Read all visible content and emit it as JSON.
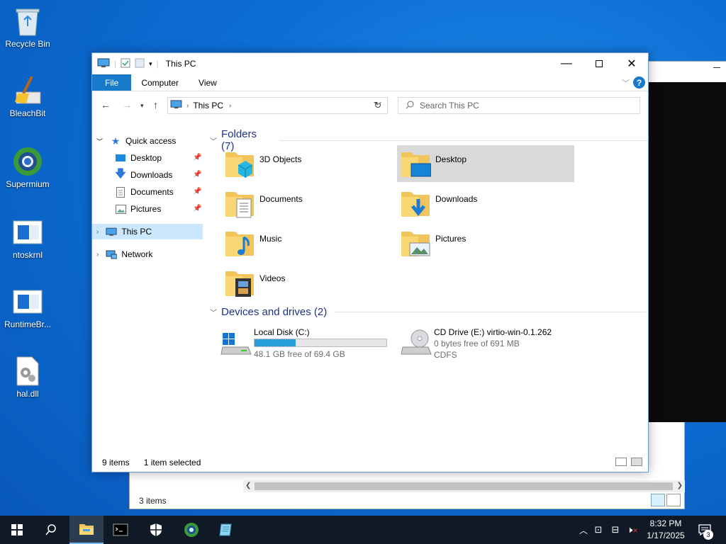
{
  "desktop_icons": [
    {
      "label": "Recycle Bin",
      "icon": "recycle-bin-icon"
    },
    {
      "label": "BleachBit",
      "icon": "broom-icon"
    },
    {
      "label": "Supermium",
      "icon": "browser-icon"
    },
    {
      "label": "ntoskrnl",
      "icon": "file-icon"
    },
    {
      "label": "RuntimeBr...",
      "icon": "file-icon"
    },
    {
      "label": "hal.dll",
      "icon": "dll-gear-icon"
    }
  ],
  "window": {
    "title": "This PC",
    "ribbon_tabs": [
      "File",
      "Computer",
      "View"
    ],
    "address_crumb": "This PC",
    "search_placeholder": "Search This PC"
  },
  "nav": {
    "quick_access": "Quick access",
    "quick_items": [
      "Desktop",
      "Downloads",
      "Documents",
      "Pictures"
    ],
    "this_pc": "This PC",
    "network": "Network"
  },
  "folders_header": "Folders (7)",
  "folders": [
    "3D Objects",
    "Desktop",
    "Documents",
    "Downloads",
    "Music",
    "Pictures",
    "Videos"
  ],
  "drives_header": "Devices and drives (2)",
  "drives": [
    {
      "name": "Local Disk (C:)",
      "free_text": "48.1 GB free of 69.4 GB",
      "used_fraction": 0.31
    },
    {
      "name": "CD Drive (E:) virtio-win-0.1.262",
      "free_text": "0 bytes free of 691 MB",
      "fs": "CDFS"
    }
  ],
  "status": {
    "items": "9 items",
    "selected": "1 item selected"
  },
  "bg_window_status": "3 items",
  "taskbar": {
    "time": "8:32 PM",
    "date": "1/17/2025",
    "notifications": "3"
  },
  "colors": {
    "accent": "#1979ca",
    "selection": "#cce8ff",
    "drive_fill": "#26a0da",
    "folder_yellow": "#f2c55c"
  }
}
